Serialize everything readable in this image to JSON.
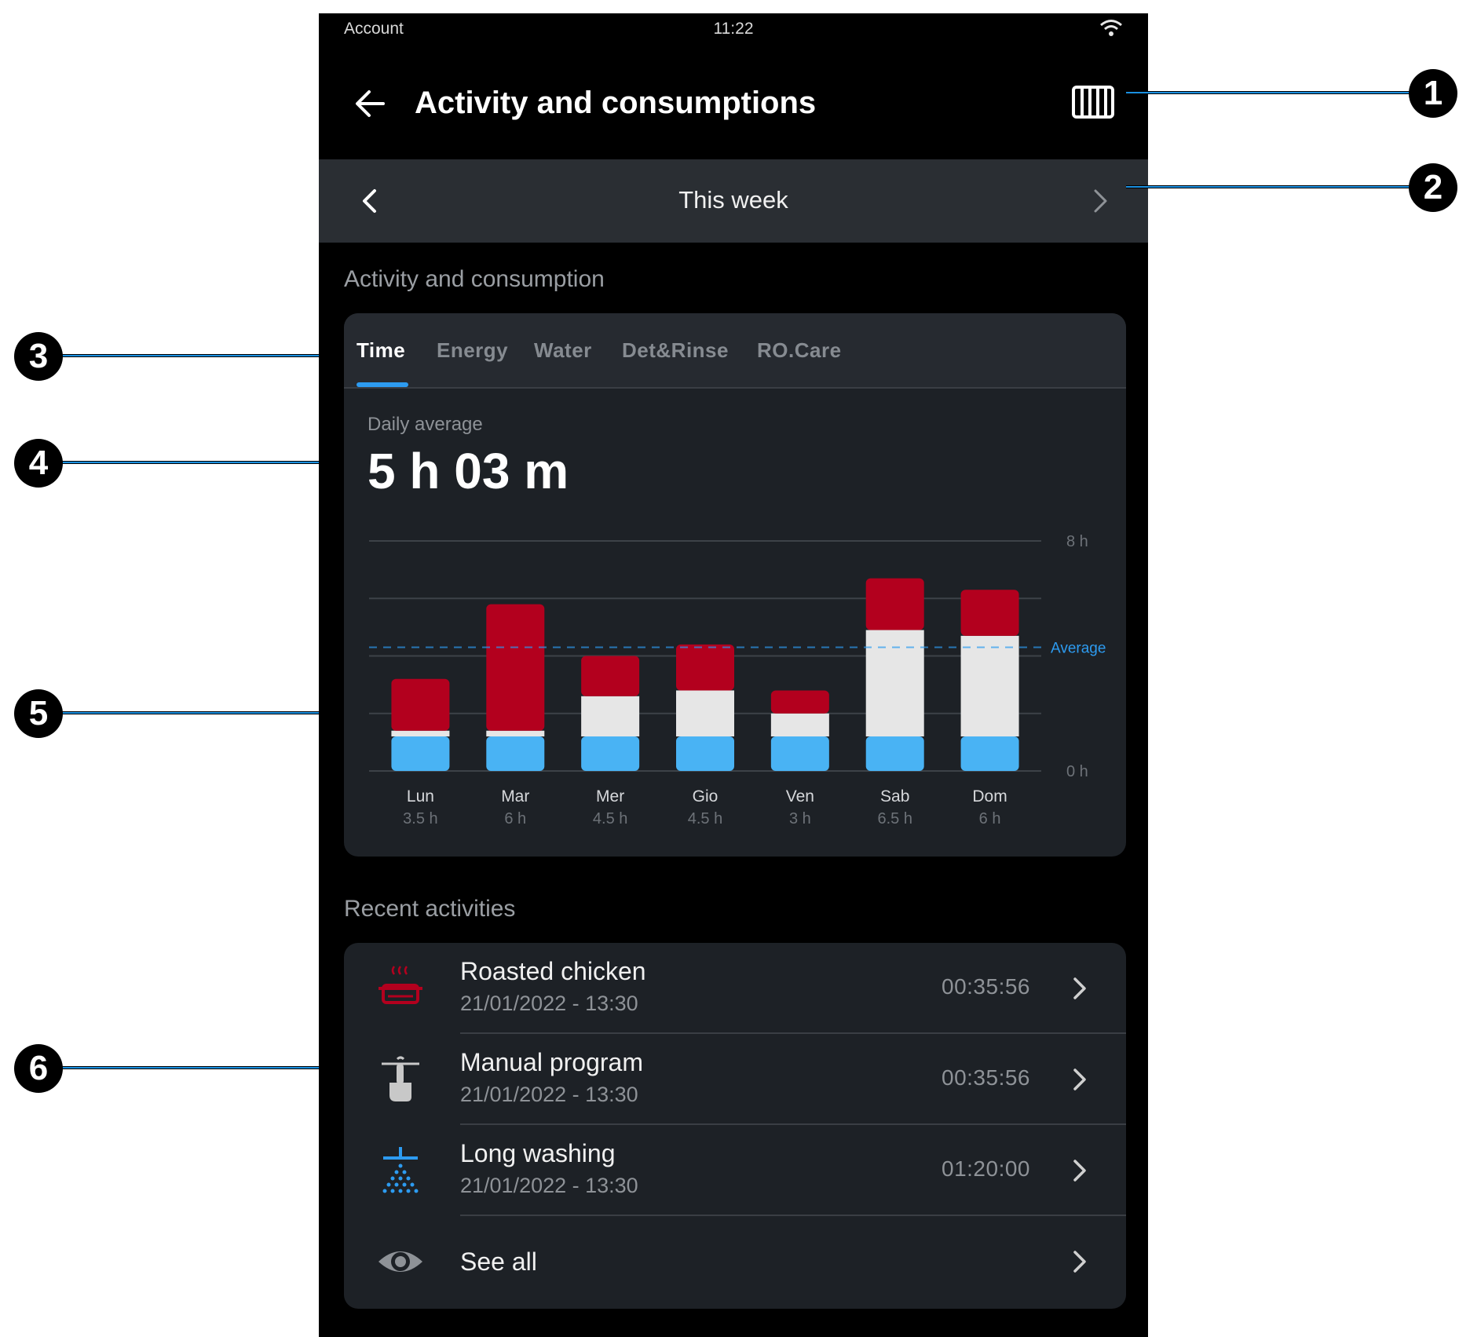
{
  "status_bar": {
    "left": "Account",
    "time": "11:22"
  },
  "header": {
    "title": "Activity and consumptions"
  },
  "period": {
    "label": "This week"
  },
  "activity": {
    "section_title": "Activity and consumption",
    "tabs": [
      {
        "label": "Time",
        "active": true
      },
      {
        "label": "Energy",
        "active": false
      },
      {
        "label": "Water",
        "active": false
      },
      {
        "label": "Det&Rinse",
        "active": false
      },
      {
        "label": "RO.Care",
        "active": false
      }
    ],
    "daily_average_label": "Daily average",
    "daily_average_value": "5 h 03 m"
  },
  "chart_data": {
    "type": "bar",
    "stacked": true,
    "categories": [
      "Lun",
      "Mar",
      "Mer",
      "Gio",
      "Ven",
      "Sab",
      "Dom"
    ],
    "category_values": [
      "3.5 h",
      "6 h",
      "4.5 h",
      "4.5 h",
      "3 h",
      "6.5 h",
      "6 h"
    ],
    "series": [
      {
        "color": "#49b3f4",
        "values": [
          1.2,
          1.2,
          1.2,
          1.2,
          1.2,
          1.2,
          1.2
        ]
      },
      {
        "color": "#e6e6e6",
        "values": [
          0.2,
          0.2,
          1.4,
          1.6,
          0.8,
          3.7,
          3.5
        ]
      },
      {
        "color": "#b3001e",
        "values": [
          1.8,
          4.4,
          1.4,
          1.6,
          0.8,
          1.8,
          1.6
        ]
      }
    ],
    "ylim": [
      0,
      8
    ],
    "ytick_labels": [
      "8 h",
      "0 h"
    ],
    "average_value": 4.3,
    "average_label": "Average",
    "average_color": "#2d9bf0"
  },
  "recent": {
    "section_title": "Recent activities",
    "items": [
      {
        "title": "Roasted chicken",
        "date": "21/01/2022 - 13:30",
        "duration": "00:35:56",
        "icon": "roasting-pot-icon"
      },
      {
        "title": "Manual program",
        "date": "21/01/2022 - 13:30",
        "duration": "00:35:56",
        "icon": "hand-touch-icon"
      },
      {
        "title": "Long washing",
        "date": "21/01/2022 - 13:30",
        "duration": "01:20:00",
        "icon": "shower-icon"
      }
    ],
    "see_all_label": "See all"
  },
  "callouts": [
    "1",
    "2",
    "3",
    "4",
    "5",
    "6"
  ]
}
